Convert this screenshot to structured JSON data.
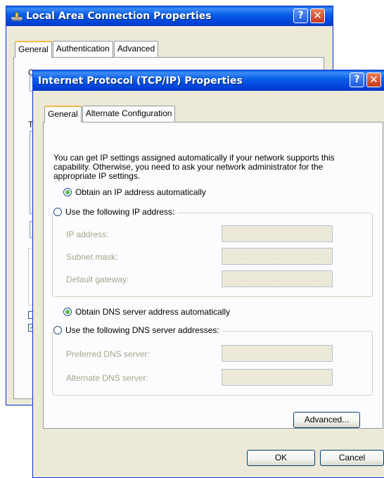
{
  "back_window": {
    "title": "Local Area Connection Properties",
    "tabs": [
      "General",
      "Authentication",
      "Advanced"
    ],
    "clipped_labels": [
      "C",
      "T"
    ],
    "check_glyph": "✓"
  },
  "front_window": {
    "title": "Internet Protocol (TCP/IP) Properties",
    "tabs": [
      "General",
      "Alternate Configuration"
    ],
    "intro_text": "You can get IP settings assigned automatically if your network supports this capability. Otherwise, you need to ask your network administrator for the appropriate IP settings.",
    "ip": {
      "auto_label": "Obtain an IP address automatically",
      "manual_label": "Use the following IP address:",
      "fields": [
        {
          "label": "IP address:"
        },
        {
          "label": "Subnet mask:"
        },
        {
          "label": "Default gateway:"
        }
      ]
    },
    "dns": {
      "auto_label": "Obtain DNS server address automatically",
      "manual_label": "Use the following DNS server addresses:",
      "fields": [
        {
          "label": "Preferred DNS server:"
        },
        {
          "label": "Alternate DNS server:"
        }
      ]
    },
    "ip_dot": ".",
    "advanced_label": "Advanced...",
    "ok_label": "OK",
    "cancel_label": "Cancel"
  },
  "titlebar_buttons": {
    "help": "?",
    "close": "✕"
  },
  "colors": {
    "titlebar": "#0a5fe8",
    "dialog_bg": "#ece9d8",
    "panel_bg": "#fcfcfe",
    "disabled_text": "#a6a38b"
  },
  "icons": [
    "network-connection-icon",
    "help-icon",
    "close-icon"
  ]
}
